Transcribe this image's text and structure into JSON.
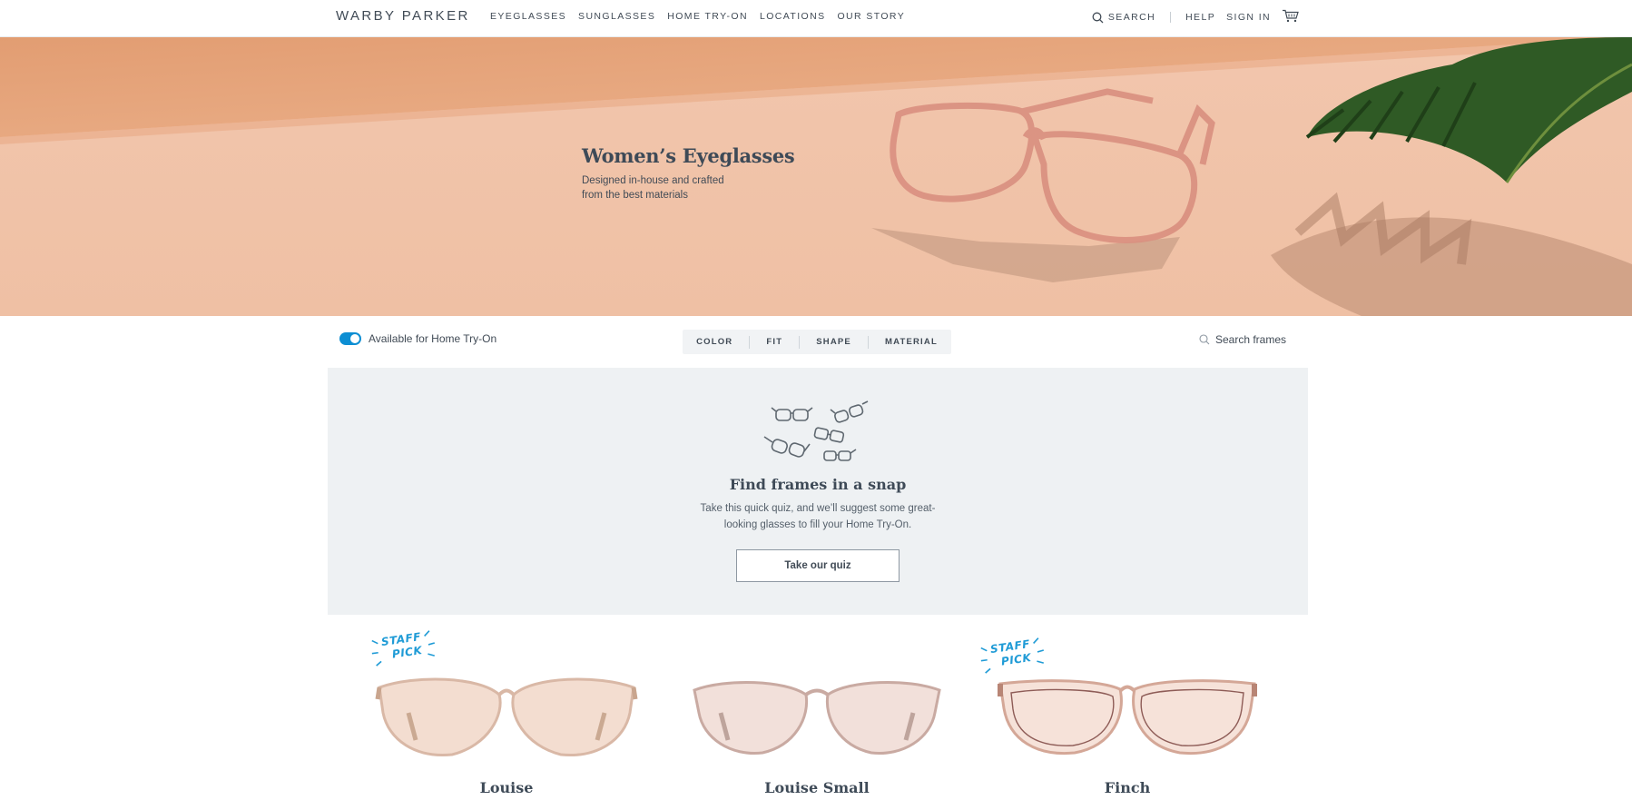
{
  "header": {
    "logo": "WARBY PARKER",
    "nav": [
      "EYEGLASSES",
      "SUNGLASSES",
      "HOME TRY-ON",
      "LOCATIONS",
      "OUR STORY"
    ],
    "search_label": "SEARCH",
    "help_label": "HELP",
    "signin_label": "SIGN IN",
    "icons": [
      "search-icon",
      "cart-icon"
    ]
  },
  "hero": {
    "title": "Women’s Eyeglasses",
    "subtitle_line1": "Designed in-house and crafted",
    "subtitle_line2": "from the best materials"
  },
  "filterbar": {
    "toggle_label": "Available for Home Try-On",
    "toggle_on": true,
    "filters": [
      "COLOR",
      "FIT",
      "SHAPE",
      "MATERIAL"
    ],
    "search_placeholder": "Search frames"
  },
  "quiz": {
    "title": "Find frames in a snap",
    "description": "Take this quick quiz, and we’ll suggest some great-looking glasses to fill your Home Try-On.",
    "button": "Take our quiz"
  },
  "products": [
    {
      "name": "Louise",
      "badge_line1": "STAFF",
      "badge_line2": "PICK",
      "staff_pick": true
    },
    {
      "name": "Louise Small",
      "staff_pick": false
    },
    {
      "name": "Finch",
      "badge_line1": "STAFF",
      "badge_line2": "PICK",
      "staff_pick": true
    }
  ],
  "colors": {
    "accent": "#0d8ed3",
    "badge": "#1f9bd6",
    "text": "#414b56",
    "quiz_bg": "#eef1f3"
  }
}
